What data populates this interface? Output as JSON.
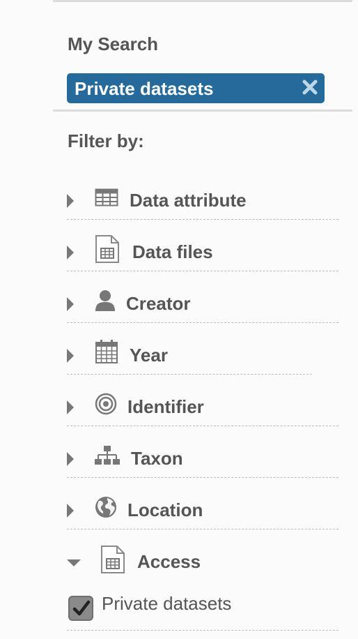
{
  "my_search": {
    "heading": "My Search",
    "active_filter": {
      "label": "Private datasets"
    }
  },
  "filters": {
    "heading": "Filter by:",
    "items": [
      {
        "label": "Data attribute",
        "icon": "table-icon",
        "expanded": false
      },
      {
        "label": "Data files",
        "icon": "file-spreadsheet-icon",
        "expanded": false
      },
      {
        "label": "Creator",
        "icon": "user-icon",
        "expanded": false
      },
      {
        "label": "Year",
        "icon": "calendar-icon",
        "expanded": false
      },
      {
        "label": "Identifier",
        "icon": "target-icon",
        "expanded": false
      },
      {
        "label": "Taxon",
        "icon": "sitemap-icon",
        "expanded": false
      },
      {
        "label": "Location",
        "icon": "globe-icon",
        "expanded": false
      },
      {
        "label": "Access",
        "icon": "file-spreadsheet-icon",
        "expanded": true
      }
    ],
    "access_options": [
      {
        "label": "Private datasets",
        "checked": true
      }
    ]
  },
  "colors": {
    "chip_background": "#256a9b",
    "text": "#555555",
    "icon": "#777777"
  }
}
